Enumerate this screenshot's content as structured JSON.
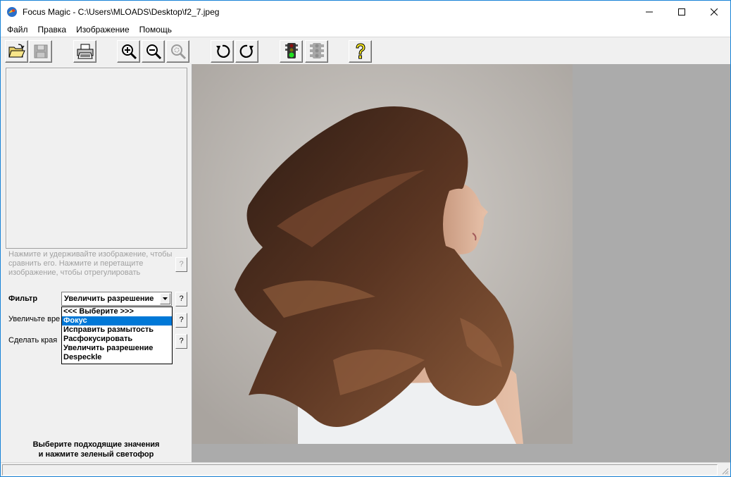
{
  "window": {
    "title": "Focus Magic - C:\\Users\\MLOADS\\Desktop\\f2_7.jpeg",
    "controls": [
      "minimize-icon",
      "maximize-icon",
      "close-icon"
    ]
  },
  "menu": {
    "file": "Файл",
    "edit": "Правка",
    "image": "Изображение",
    "help": "Помощь"
  },
  "toolbar": {
    "buttons": [
      "open-folder-icon",
      "save-disk-icon",
      "print-icon",
      "zoom-in-icon",
      "zoom-out-icon",
      "zoom-fit-icon",
      "rotate-left-icon",
      "rotate-right-icon",
      "traffic-light-green-icon",
      "traffic-light-off-icon",
      "help-question-icon"
    ]
  },
  "left_panel": {
    "hint": "Нажмите и удерживайте изображение, чтобы сравнить его. Нажмите и перетащите изображение, чтобы отрегулировать",
    "filter_label": "Фильтр",
    "filter_value": "Увеличить разрешение",
    "increase_label": "Увеличьте вре",
    "edges_label": "Сделать края",
    "help_q": "?",
    "bottom_hint_line1": "Выберите подходящие значения",
    "bottom_hint_line2": "и нажмите зеленый светофор"
  },
  "dropdown": {
    "items": [
      "<<< Выберите >>>",
      "Фокус",
      "Исправить размытость",
      "Расфокусировать",
      "Увеличить разрешение",
      "Despeckle"
    ],
    "selected_index": 1
  },
  "colors": {
    "selection": "#0078d7",
    "canvas_bg": "#ababab",
    "hair_dark": "#3a2418",
    "hair_light": "#8a5a3a"
  }
}
